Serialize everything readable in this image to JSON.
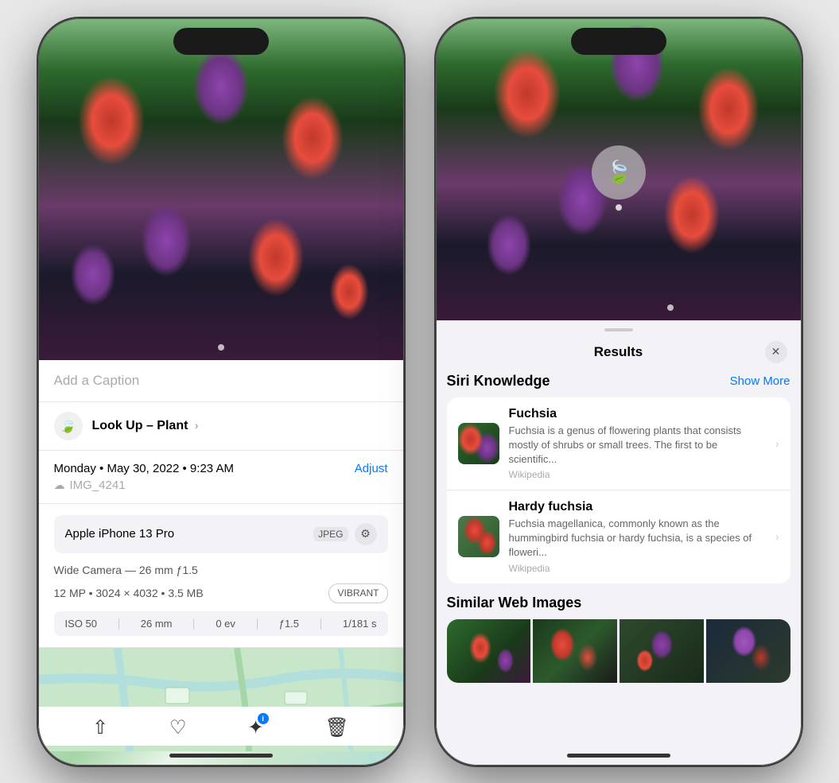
{
  "phone1": {
    "caption": {
      "placeholder": "Add a Caption"
    },
    "lookup": {
      "label": "Look Up",
      "separator": "–",
      "subject": "Plant"
    },
    "meta": {
      "date": "Monday • May 30, 2022 • 9:23 AM",
      "adjust_label": "Adjust",
      "filename": "IMG_4241"
    },
    "camera": {
      "model": "Apple iPhone 13 Pro",
      "format": "JPEG",
      "lens": "Wide Camera — 26 mm ƒ1.5",
      "mp": "12 MP • 3024 × 4032 • 3.5 MB",
      "style": "VIBRANT",
      "iso": "ISO 50",
      "focal": "26 mm",
      "ev": "0 ev",
      "aperture": "ƒ1.5",
      "shutter": "1/181 s"
    },
    "toolbar": {
      "share": "⬆",
      "favorite": "♡",
      "info": "ℹ",
      "delete": "🗑"
    }
  },
  "phone2": {
    "results": {
      "title": "Results",
      "close": "✕"
    },
    "siri_knowledge": {
      "section_title": "Siri Knowledge",
      "show_more": "Show More",
      "items": [
        {
          "name": "Fuchsia",
          "description": "Fuchsia is a genus of flowering plants that consists mostly of shrubs or small trees. The first to be scientific...",
          "source": "Wikipedia"
        },
        {
          "name": "Hardy fuchsia",
          "description": "Fuchsia magellanica, commonly known as the hummingbird fuchsia or hardy fuchsia, is a species of floweri...",
          "source": "Wikipedia"
        }
      ]
    },
    "similar_images": {
      "section_title": "Similar Web Images"
    }
  }
}
